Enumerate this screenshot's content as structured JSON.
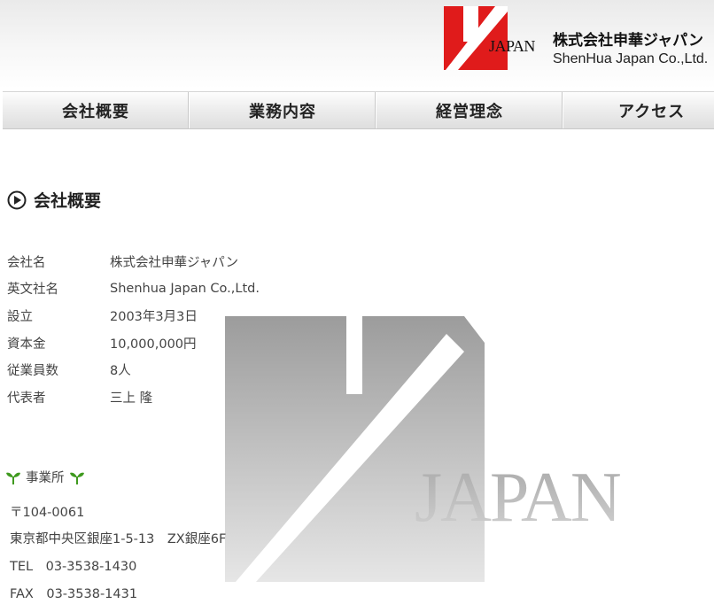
{
  "header": {
    "logo_word": "JAPAN",
    "company_name_jp": "株式会社申華ジャパン",
    "company_name_en": "ShenHua Japan Co.,Ltd."
  },
  "nav": {
    "items": [
      {
        "label": "会社概要"
      },
      {
        "label": "業務内容"
      },
      {
        "label": "経営理念"
      },
      {
        "label": "アクセス"
      }
    ]
  },
  "section": {
    "title": "会社概要"
  },
  "company_info": [
    {
      "label": "会社名",
      "value": "株式会社申華ジャパン"
    },
    {
      "label": "英文社名",
      "value": "Shenhua Japan Co.,Ltd."
    },
    {
      "label": "設立",
      "value": "2003年3月3日"
    },
    {
      "label": "資本金",
      "value": "10,000,000円"
    },
    {
      "label": "従業員数",
      "value": "8人"
    },
    {
      "label": "代表者",
      "value": "三上 隆"
    }
  ],
  "office": {
    "heading": "事業所",
    "postal": "〒104-0061",
    "address": "東京都中央区銀座1-5-13　ZX銀座6F",
    "tel": "TEL　03-3538-1430",
    "fax": "FAX　03-3538-1431"
  },
  "watermark": {
    "word": "JAPAN"
  },
  "colors": {
    "brand_red": "#e01b1b",
    "nav_text": "#222222",
    "body_text": "#444444",
    "sprout_green": "#3f9a1f"
  }
}
